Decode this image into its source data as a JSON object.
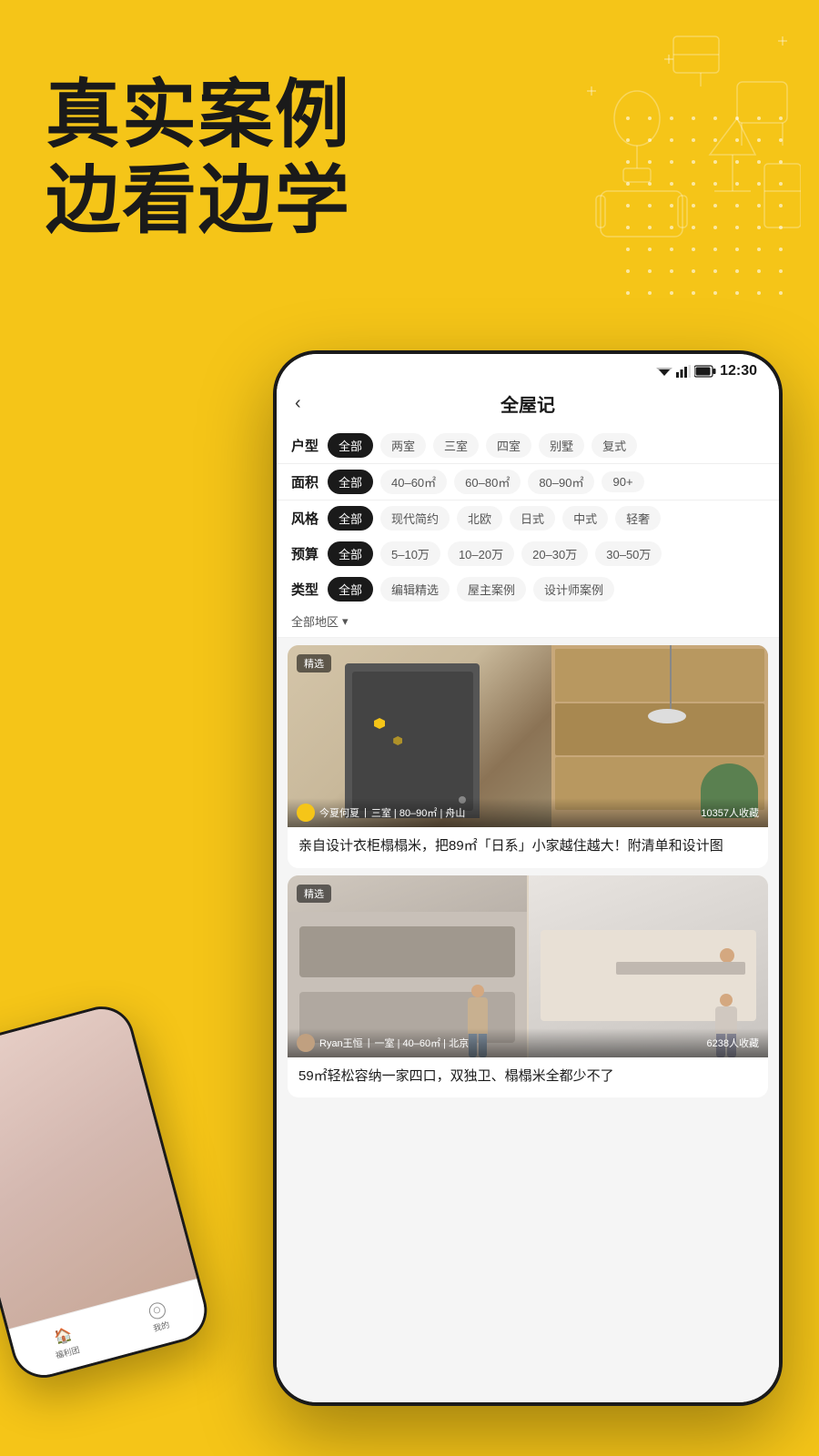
{
  "background": {
    "color": "#F5C518"
  },
  "headline": {
    "line1": "真实案例",
    "line2": "边看边学"
  },
  "status_bar": {
    "time": "12:30"
  },
  "app_header": {
    "back": "‹",
    "title": "全屋记"
  },
  "filters": [
    {
      "label": "户型",
      "tags": [
        "全部",
        "两室",
        "三室",
        "四室",
        "别墅",
        "复式"
      ],
      "active": "全部"
    },
    {
      "label": "面积",
      "tags": [
        "全部",
        "40–60㎡",
        "60–80㎡",
        "80–90㎡",
        "90+"
      ],
      "active": "全部"
    },
    {
      "label": "风格",
      "tags": [
        "全部",
        "现代简约",
        "北欧",
        "日式",
        "中式",
        "轻奢"
      ],
      "active": "全部"
    },
    {
      "label": "预算",
      "tags": [
        "全部",
        "5–10万",
        "10–20万",
        "20–30万",
        "30–50万"
      ],
      "active": "全部"
    },
    {
      "label": "类型",
      "tags": [
        "全部",
        "编辑精选",
        "屋主案例",
        "设计师案例"
      ],
      "active": "全部"
    }
  ],
  "location": {
    "label": "全部地区",
    "arrow": "▾"
  },
  "cards": [
    {
      "badge": "精选",
      "user_name": "今夏何夏",
      "room_info": "三室 | 80–90㎡ | 舟山",
      "saves": "10357人收藏",
      "title": "亲自设计衣柜榻榻米，把89㎡「日系」小家越住越大！附清单和设计图"
    },
    {
      "badge": "精选",
      "user_name": "Ryan王恒",
      "room_info": "一室 | 40–60㎡ | 北京",
      "saves": "6238人收藏",
      "title": "59㎡轻松容纳一家四口，双独卫、榻榻米全都少不了"
    }
  ],
  "small_phone": {
    "nav_items": [
      {
        "icon": "🏠",
        "label": "福利团"
      },
      {
        "icon": "○",
        "label": "我的"
      }
    ]
  }
}
